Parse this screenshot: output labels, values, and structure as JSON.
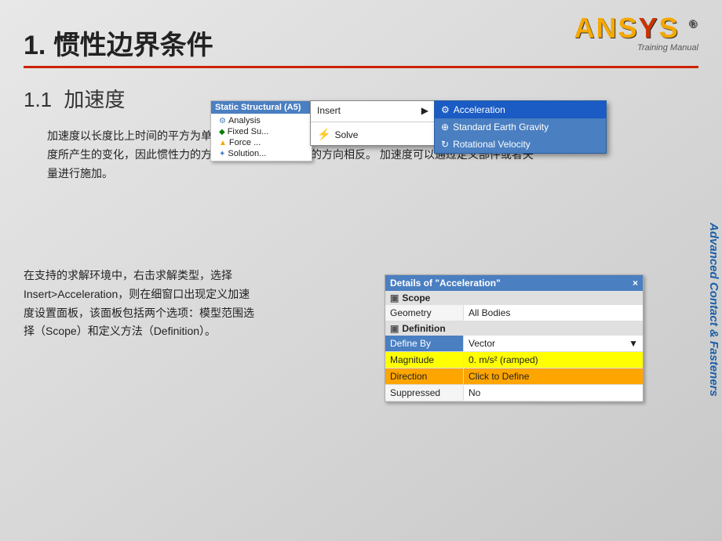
{
  "page": {
    "background": "#d0d0d0"
  },
  "header": {
    "section_number": "1.",
    "section_title": "惯性边界条件",
    "subsection_number": "1.1",
    "subsection_title": "加速度"
  },
  "ansys": {
    "logo": "ANSYS",
    "registered": "®",
    "subtitle": "Training Manual"
  },
  "vertical_label": "Advanced Contact & Fasteners",
  "red_line": true,
  "body_text_top": "加速度以长度比上时间的平方为单位作用在整个模型上。由于加速度施加到系统上，惯性将阻止加速度所产生的变化，因此惯性力的方向与所施加的加速度的方向相反。 加速度可以通过定义部件或者矢量进行施加。",
  "body_text_left": "在支持的求解环境中，右击求解类型，选择Insert>Acceleration，则在细窗口出现定义加速度设置面板，该面板包括两个选项：模型范围选择（Scope）和定义方法（Definition）。",
  "tree_title": "Static Structural (A5)",
  "tree_items": [
    {
      "label": "Analysis",
      "icon": "analysis"
    },
    {
      "label": "Fixed Su...",
      "icon": "fixed"
    },
    {
      "label": "Force ...",
      "icon": "force"
    },
    {
      "label": "Solution...",
      "icon": "solution"
    }
  ],
  "context_menu": {
    "items": [
      {
        "label": "Insert",
        "has_arrow": true,
        "highlighted": false
      },
      {
        "label": "Solve",
        "has_lightning": true,
        "highlighted": false
      }
    ]
  },
  "accel_submenu": {
    "items": [
      {
        "label": "Acceleration",
        "highlighted": true
      },
      {
        "label": "Standard Earth Gravity",
        "highlighted": false
      },
      {
        "label": "Rotational Velocity",
        "highlighted": false
      }
    ]
  },
  "details_panel": {
    "title": "Details of \"Acceleration\"",
    "close_icon": "×",
    "sections": [
      {
        "name": "Scope",
        "rows": [
          {
            "label": "Geometry",
            "value": "All Bodies",
            "style": "normal"
          }
        ]
      },
      {
        "name": "Definition",
        "rows": [
          {
            "label": "Define By",
            "value": "Vector",
            "style": "blue",
            "has_dropdown": true
          },
          {
            "label": "Magnitude",
            "value": "0. m/s² (ramped)",
            "style": "yellow"
          },
          {
            "label": "Direction",
            "value": "Click to Define",
            "style": "orange"
          },
          {
            "label": "Suppressed",
            "value": "No",
            "style": "normal"
          }
        ]
      }
    ]
  }
}
